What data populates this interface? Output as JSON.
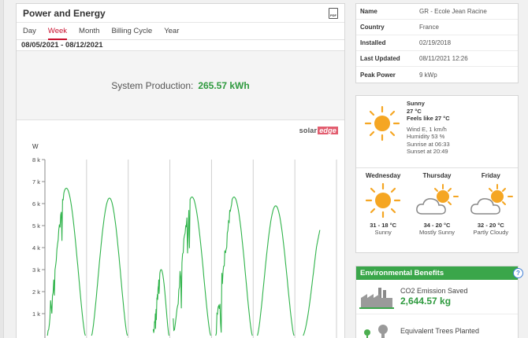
{
  "power_energy": {
    "title": "Power and Energy",
    "pdf_icon_text": "PDF",
    "tabs": [
      {
        "label": "Day",
        "active": false
      },
      {
        "label": "Week",
        "active": true
      },
      {
        "label": "Month",
        "active": false
      },
      {
        "label": "Billing Cycle",
        "active": false
      },
      {
        "label": "Year",
        "active": false
      }
    ],
    "date_range": "08/05/2021 - 08/12/2021",
    "production_label": "System Production:",
    "production_value": "265.57 kWh",
    "logo_solar": "solar",
    "logo_edge": "edge"
  },
  "chart_data": {
    "type": "line",
    "ylabel": "W",
    "yticks": [
      "8 k",
      "7 k",
      "6 k",
      "5 k",
      "4 k",
      "3 k",
      "2 k",
      "1 k"
    ],
    "ylim": [
      0,
      8000
    ],
    "line_color": "#2fb34a",
    "days": [
      {
        "start": 0.06,
        "end": 0.97,
        "peak": 6700,
        "jitter": true
      },
      {
        "start": 0.12,
        "end": 0.98,
        "peak": 6250,
        "jitter": false
      },
      {
        "start": 0.6,
        "end": 0.98,
        "peak": 3000,
        "jitter": true
      },
      {
        "start": 0.08,
        "end": 0.98,
        "peak": 6300,
        "jitter": true
      },
      {
        "start": 0.1,
        "end": 0.98,
        "peak": 6300,
        "jitter": true
      },
      {
        "start": 0.1,
        "end": 0.98,
        "peak": 5900,
        "jitter": false
      },
      {
        "start": 0.2,
        "end": 0.6,
        "peak": 4800,
        "jitter": false,
        "partial": true
      }
    ]
  },
  "site_info": [
    {
      "key": "Name",
      "value": "GR - Ecole Jean Racine"
    },
    {
      "key": "Country",
      "value": "France"
    },
    {
      "key": "Installed",
      "value": "02/19/2018"
    },
    {
      "key": "Last Updated",
      "value": "08/11/2021 12:26"
    },
    {
      "key": "Peak Power",
      "value": "9 kWp"
    }
  ],
  "weather": {
    "current": {
      "condition": "Sunny",
      "temp": "27 °C",
      "feels_like": "Feels like 27 °C",
      "wind": "Wind E, 1 km/h",
      "humidity": "Humidity 53 %",
      "sunrise": "Sunrise at 06:33",
      "sunset": "Sunset at 20:49",
      "icon": "sun-icon"
    },
    "forecast": [
      {
        "day": "Wednesday",
        "temps": "31 - 18 °C",
        "condition": "Sunny",
        "icon": "sun-icon"
      },
      {
        "day": "Thursday",
        "temps": "34 - 20 °C",
        "condition": "Mostly Sunny",
        "icon": "sun-cloud-icon"
      },
      {
        "day": "Friday",
        "temps": "32 - 20 °C",
        "condition": "Partly Cloudy",
        "icon": "sun-cloud-icon"
      }
    ]
  },
  "env": {
    "title": "Environmental Benefits",
    "help": "?",
    "items": [
      {
        "label": "CO2 Emission Saved",
        "value": "2,644.57 kg",
        "icon": "factory-icon"
      },
      {
        "label": "Equivalent Trees Planted",
        "value": "",
        "icon": "tree-icon"
      }
    ]
  },
  "colors": {
    "accent_red": "#c8102e",
    "green": "#2e9a3e",
    "env_green": "#3aa64a",
    "sun": "#f5a623"
  }
}
